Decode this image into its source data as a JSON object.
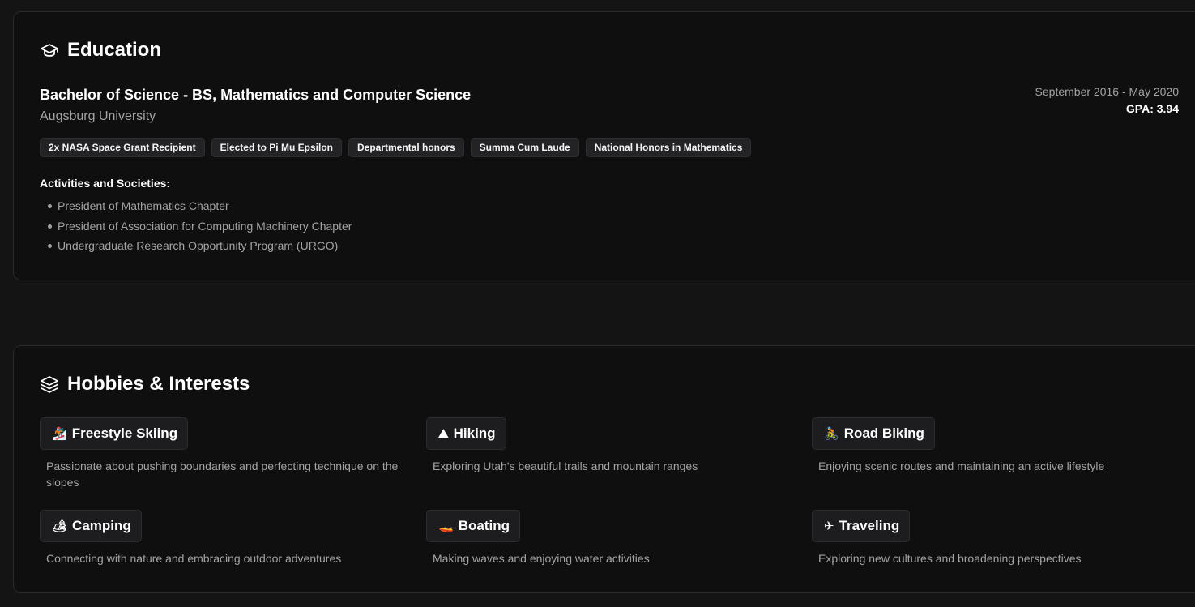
{
  "education": {
    "title": "Education",
    "icon": "graduation-cap-icon",
    "degree": "Bachelor of Science - BS, Mathematics and Computer Science",
    "school": "Augsburg University",
    "dates": "September 2016 - May 2020",
    "gpa": "GPA: 3.94",
    "honors": [
      "2x NASA Space Grant Recipient",
      "Elected to Pi Mu Epsilon",
      "Departmental honors",
      "Summa Cum Laude",
      "National Honors in Mathematics"
    ],
    "activities_label": "Activities and Societies:",
    "activities": [
      "President of Mathematics Chapter",
      "President of Association for Computing Machinery Chapter",
      "Undergraduate Research Opportunity Program (URGO)"
    ]
  },
  "hobbies": {
    "title": "Hobbies & Interests",
    "icon": "layers-icon",
    "items": [
      {
        "emoji": "🏂",
        "name": "Freestyle Skiing",
        "desc": "Passionate about pushing boundaries and perfecting technique on the slopes"
      },
      {
        "emoji": "⛰",
        "name": "Hiking",
        "desc": "Exploring Utah's beautiful trails and mountain ranges"
      },
      {
        "emoji": "🚴",
        "name": "Road Biking",
        "desc": "Enjoying scenic routes and maintaining an active lifestyle"
      },
      {
        "emoji": "🏕",
        "name": "Camping",
        "desc": "Connecting with nature and embracing outdoor adventures"
      },
      {
        "emoji": "🚤",
        "name": "Boating",
        "desc": "Making waves and enjoying water activities"
      },
      {
        "emoji": "✈",
        "name": "Traveling",
        "desc": "Exploring new cultures and broadening perspectives"
      }
    ]
  },
  "colors": {
    "background": "#141414",
    "card": "#0f0f10",
    "muted_text": "#a3a3a3",
    "badge": "#232325"
  }
}
